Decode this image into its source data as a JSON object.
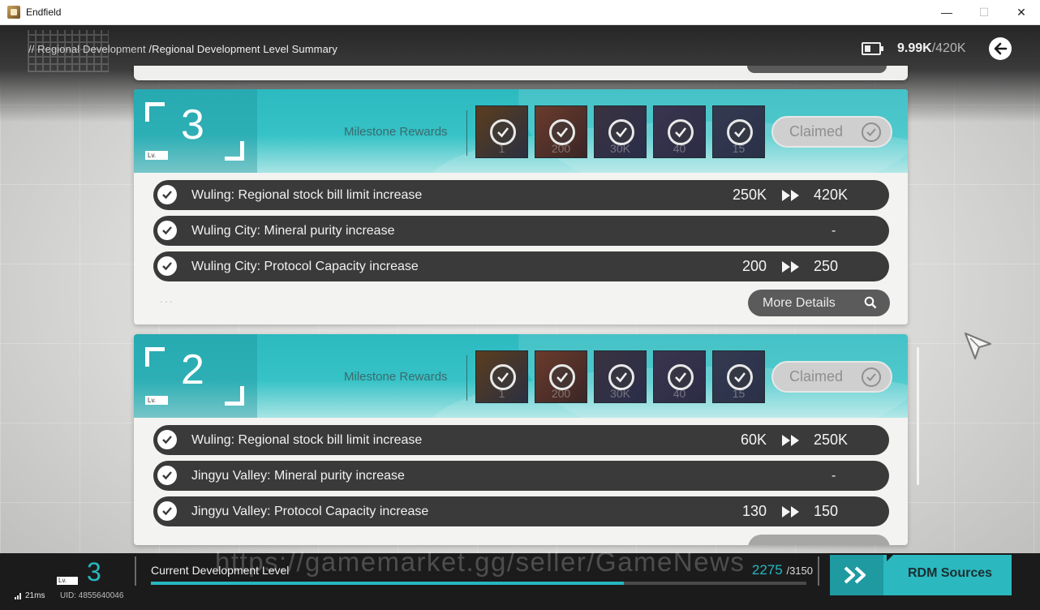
{
  "window": {
    "title": "Endfield",
    "minimize": "—",
    "maximize": "☐",
    "close": "✕"
  },
  "breadcrumb": {
    "prefix": "// Regional Development",
    "current": "/Regional Development Level Summary"
  },
  "currency": {
    "value": "9.99K",
    "max": "/420K",
    "icon": "stock-bill-icon"
  },
  "cards": [
    {
      "level": "3",
      "lv_tag": "Lv.",
      "milestone_label": "Milestone Rewards",
      "rewards": [
        {
          "count": "1",
          "colors": [
            "#5b3d1e",
            "#2b3040"
          ]
        },
        {
          "count": "200",
          "colors": [
            "#6b3b2c",
            "#3a2626"
          ]
        },
        {
          "count": "30K",
          "colors": [
            "#3a3340",
            "#2a2d4a"
          ]
        },
        {
          "count": "40",
          "colors": [
            "#3a3550",
            "#2c2c44"
          ]
        },
        {
          "count": "15",
          "colors": [
            "#343a50",
            "#2a3048"
          ]
        }
      ],
      "claimed_label": "Claimed",
      "rows": [
        {
          "text": "Wuling: Regional stock bill limit increase",
          "from": "250K",
          "to": "420K"
        },
        {
          "text": "Wuling City: Mineral purity increase",
          "dash": "-"
        },
        {
          "text": "Wuling City: Protocol Capacity increase",
          "from": "200",
          "to": "250"
        }
      ],
      "ellipsis": "...",
      "details_label": "More Details"
    },
    {
      "level": "2",
      "lv_tag": "Lv.",
      "milestone_label": "Milestone Rewards",
      "rewards": [
        {
          "count": "1",
          "colors": [
            "#5b3d1e",
            "#2b3040"
          ]
        },
        {
          "count": "200",
          "colors": [
            "#6b3b2c",
            "#3a2626"
          ]
        },
        {
          "count": "30K",
          "colors": [
            "#3a3340",
            "#2a2d4a"
          ]
        },
        {
          "count": "40",
          "colors": [
            "#3a3550",
            "#2c2c44"
          ]
        },
        {
          "count": "15",
          "colors": [
            "#343a50",
            "#2a3048"
          ]
        }
      ],
      "claimed_label": "Claimed",
      "rows": [
        {
          "text": "Wuling: Regional stock bill limit increase",
          "from": "60K",
          "to": "250K"
        },
        {
          "text": "Jingyu Valley: Mineral purity increase",
          "dash": "-"
        },
        {
          "text": "Jingyu Valley: Protocol Capacity increase",
          "from": "130",
          "to": "150"
        }
      ]
    }
  ],
  "bottom": {
    "lv_tag": "Lv.",
    "level": "3",
    "ping": "21ms",
    "uid": "UID: 4855640046",
    "dev_label": "Current Development Level",
    "dev_current": "2275",
    "dev_max": "/3150",
    "progress_fraction": 0.722,
    "watermark": "https://gamemarket.gg/seller/GameNews",
    "rdm_label": "RDM Sources"
  },
  "colors": {
    "accent": "#27b7c0",
    "row_bg": "#3a3a3a",
    "header_teal": "#2cbac0"
  }
}
